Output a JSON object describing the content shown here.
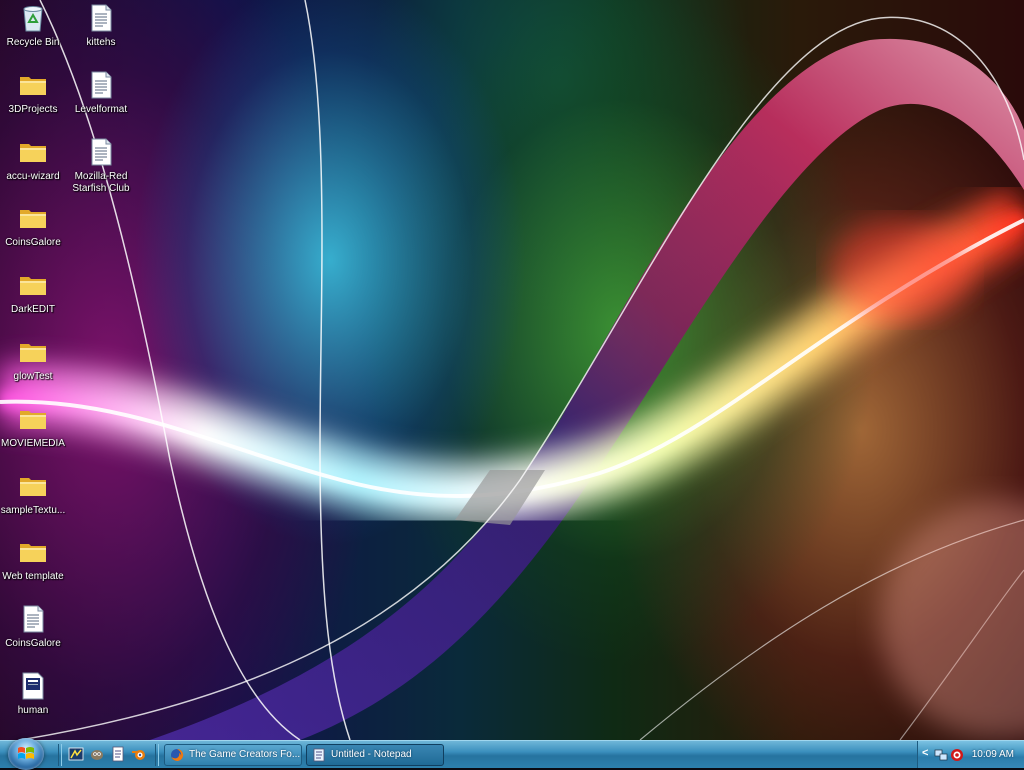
{
  "desktop": {
    "icons_col1": [
      {
        "label": "Recycle Bin",
        "icon": "recycle-bin-icon"
      },
      {
        "label": "3DProjects",
        "icon": "folder-icon"
      },
      {
        "label": "accu-wizard",
        "icon": "folder-icon"
      },
      {
        "label": "CoinsGalore",
        "icon": "folder-icon"
      },
      {
        "label": "DarkEDIT",
        "icon": "folder-icon"
      },
      {
        "label": "glowTest",
        "icon": "folder-icon"
      },
      {
        "label": "MOVIEMEDIA",
        "icon": "folder-icon"
      },
      {
        "label": "sampleTextu...",
        "icon": "folder-icon"
      },
      {
        "label": "Web template",
        "icon": "folder-icon"
      },
      {
        "label": "CoinsGalore",
        "icon": "text-file-icon"
      },
      {
        "label": "human",
        "icon": "document-file-icon"
      }
    ],
    "icons_col2": [
      {
        "label": "kittehs",
        "icon": "text-file-icon"
      },
      {
        "label": "Levelformat",
        "icon": "text-file-icon"
      },
      {
        "label": "Mozilla-Red Starfish Club",
        "icon": "text-file-icon"
      }
    ]
  },
  "taskbar": {
    "tasks": [
      {
        "label": "The Game Creators Fo...",
        "icon": "firefox-icon",
        "active": false
      },
      {
        "label": "Untitled - Notepad",
        "icon": "notepad-icon",
        "active": true
      }
    ],
    "tray": {
      "expand_label": "<",
      "clock": "10:09 AM"
    }
  },
  "colors": {
    "taskbar_top": "#6fb6d8",
    "taskbar_bottom": "#2d80ad",
    "folder": "#f3c94a"
  }
}
